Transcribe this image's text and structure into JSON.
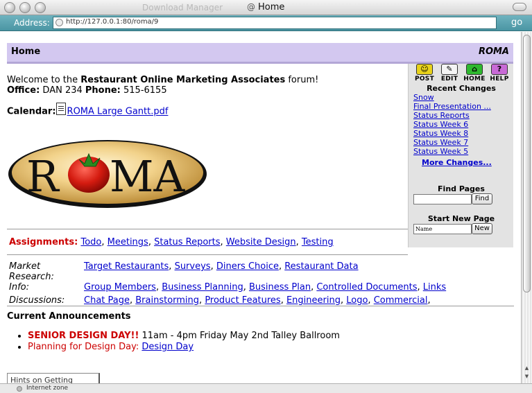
{
  "window": {
    "title_background": "Download Manager",
    "title": "Home"
  },
  "address": {
    "label": "Address:",
    "url": "http://127.0.0.1:80/roma/9",
    "go_label": "go"
  },
  "status": {
    "text": "Internet zone"
  },
  "header": {
    "home": "Home",
    "site_name": "ROMA"
  },
  "welcome": {
    "line1_prefix": "Welcome to the ",
    "org_name": "Restaurant Online Marketing Associates",
    "line1_suffix": " forum!",
    "office_label": "Office:",
    "office_value": " DAN 234 ",
    "phone_label": "Phone:",
    "phone_value": " 515-6155"
  },
  "calendar": {
    "label": "Calendar:",
    "link": "ROMA Large Gantt.pdf"
  },
  "logo": {
    "text_left": "R",
    "text_right": "MA"
  },
  "assignments": {
    "label": "Assignments:",
    "items": [
      "Todo",
      "Meetings",
      "Status Reports",
      "Website Design",
      "Testing"
    ]
  },
  "link_groups": [
    {
      "label": "Market Research:",
      "links": [
        "Target Restaurants",
        "Surveys",
        "Diners Choice",
        "Restaurant Data"
      ]
    },
    {
      "label": "Info:",
      "links": [
        "Group Members",
        "Business Planning",
        "Business Plan",
        "Controlled Documents",
        "Links"
      ]
    },
    {
      "label": "Discussions:",
      "links": [
        "Chat Page",
        "Brainstorming",
        "Product Features",
        "Engineering",
        "Logo",
        "Commercial"
      ]
    }
  ],
  "announcements": {
    "title": "Current Announcements",
    "item1_bold": "SENIOR DESIGN DAY!!",
    "item1_text": " 11am - 4pm Friday May 2nd Talley Ballroom",
    "item2_text": "Planning for Design Day: ",
    "item2_link": "Design Day"
  },
  "hints_tab": "Hints on Getting Started",
  "sidebar": {
    "actions": [
      {
        "label": "POST",
        "icon": "post-icon",
        "color": "#e8d21a"
      },
      {
        "label": "EDIT",
        "icon": "edit-icon",
        "color": "#f4f4f4"
      },
      {
        "label": "HOME",
        "icon": "home-icon",
        "color": "#2fb82f"
      },
      {
        "label": "HELP",
        "icon": "help-icon",
        "color": "#c86ad6"
      }
    ],
    "recent_title": "Recent Changes",
    "recent": [
      "Snow",
      "Final Presentation ...",
      "Status Reports",
      "Status Week 6",
      "Status Week 8",
      "Status Week 7",
      "Status Week 5"
    ],
    "more": "More Changes...",
    "find_title": "Find Pages",
    "find_button": "Find",
    "new_title": "Start New Page",
    "new_placeholder": "Name",
    "new_button": "New"
  },
  "colors": {
    "header_bg": "#d3c8f0",
    "link": "#0000cc",
    "alert_red": "#cc0000",
    "address_bar": "#4a95a3"
  }
}
